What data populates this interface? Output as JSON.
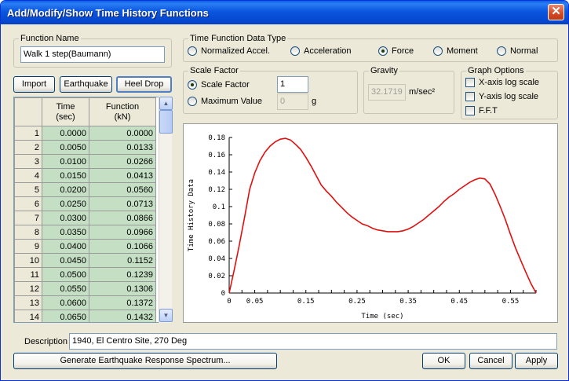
{
  "window": {
    "title": "Add/Modify/Show Time History Functions",
    "close_glyph": "✕"
  },
  "function_name": {
    "label": "Function Name",
    "value": "Walk 1 step(Baumann)"
  },
  "data_type": {
    "label": "Time Function Data Type",
    "options": [
      "Normalized Accel.",
      "Acceleration",
      "Force",
      "Moment",
      "Normal"
    ],
    "selected": "Force"
  },
  "buttons": {
    "import": "Import",
    "earthquake": "Earthquake",
    "heel_drop": "Heel Drop",
    "generate": "Generate Earthquake Response Spectrum...",
    "ok": "OK",
    "cancel": "Cancel",
    "apply": "Apply"
  },
  "scale": {
    "label": "Scale Factor",
    "options": [
      "Scale Factor",
      "Maximum Value"
    ],
    "selected": "Scale Factor",
    "scale_value": "1",
    "max_value": "0",
    "max_unit": "g"
  },
  "gravity": {
    "label": "Gravity",
    "value": "32.1719",
    "unit": "m/sec²"
  },
  "graph_options": {
    "label": "Graph Options",
    "items": [
      {
        "label": "X-axis log scale",
        "checked": false
      },
      {
        "label": "Y-axis log scale",
        "checked": false
      },
      {
        "label": "F.F.T",
        "checked": false
      }
    ]
  },
  "table": {
    "headers": [
      [
        "Time",
        "(sec)"
      ],
      [
        "Function",
        "(kN)"
      ]
    ],
    "rows": [
      [
        "1",
        "0.0000",
        "0.0000"
      ],
      [
        "2",
        "0.0050",
        "0.0133"
      ],
      [
        "3",
        "0.0100",
        "0.0266"
      ],
      [
        "4",
        "0.0150",
        "0.0413"
      ],
      [
        "5",
        "0.0200",
        "0.0560"
      ],
      [
        "6",
        "0.0250",
        "0.0713"
      ],
      [
        "7",
        "0.0300",
        "0.0866"
      ],
      [
        "8",
        "0.0350",
        "0.0966"
      ],
      [
        "9",
        "0.0400",
        "0.1066"
      ],
      [
        "10",
        "0.0450",
        "0.1152"
      ],
      [
        "11",
        "0.0500",
        "0.1239"
      ],
      [
        "12",
        "0.0550",
        "0.1306"
      ],
      [
        "13",
        "0.0600",
        "0.1372"
      ],
      [
        "14",
        "0.0650",
        "0.1432"
      ]
    ]
  },
  "description": {
    "label": "Description",
    "value": "1940, El Centro Site, 270 Deg"
  },
  "scroll_glyphs": {
    "up": "▲",
    "down": "▼"
  },
  "chart_data": {
    "type": "line",
    "xlabel": "Time (sec)",
    "ylabel": "Time History Data",
    "xlim": [
      0,
      0.6
    ],
    "ylim": [
      0,
      0.18
    ],
    "x_ticks": [
      "0",
      "0.05",
      "0.15",
      "0.25",
      "0.35",
      "0.45",
      "0.55"
    ],
    "y_ticks": [
      "0",
      "0.02",
      "0.04",
      "0.06",
      "0.08",
      "0.1",
      "0.12",
      "0.14",
      "0.16",
      "0.18"
    ],
    "line_color": "#e01010",
    "x": [
      0,
      0.01,
      0.02,
      0.03,
      0.04,
      0.05,
      0.06,
      0.07,
      0.08,
      0.09,
      0.1,
      0.11,
      0.12,
      0.13,
      0.14,
      0.15,
      0.16,
      0.17,
      0.18,
      0.19,
      0.2,
      0.21,
      0.22,
      0.23,
      0.24,
      0.25,
      0.26,
      0.27,
      0.28,
      0.29,
      0.3,
      0.31,
      0.32,
      0.33,
      0.34,
      0.35,
      0.36,
      0.37,
      0.38,
      0.39,
      0.4,
      0.41,
      0.42,
      0.43,
      0.44,
      0.45,
      0.46,
      0.47,
      0.48,
      0.49,
      0.5,
      0.51,
      0.52,
      0.53,
      0.54,
      0.55,
      0.56,
      0.57,
      0.58,
      0.59,
      0.6
    ],
    "y": [
      0,
      0.027,
      0.056,
      0.087,
      0.12,
      0.139,
      0.153,
      0.163,
      0.17,
      0.175,
      0.178,
      0.179,
      0.177,
      0.172,
      0.166,
      0.157,
      0.147,
      0.136,
      0.125,
      0.118,
      0.112,
      0.105,
      0.099,
      0.093,
      0.088,
      0.084,
      0.08,
      0.078,
      0.075,
      0.073,
      0.072,
      0.071,
      0.071,
      0.071,
      0.072,
      0.074,
      0.077,
      0.081,
      0.085,
      0.09,
      0.095,
      0.1,
      0.106,
      0.111,
      0.115,
      0.12,
      0.124,
      0.128,
      0.131,
      0.133,
      0.132,
      0.126,
      0.114,
      0.1,
      0.085,
      0.068,
      0.052,
      0.038,
      0.024,
      0.011,
      0
    ]
  }
}
